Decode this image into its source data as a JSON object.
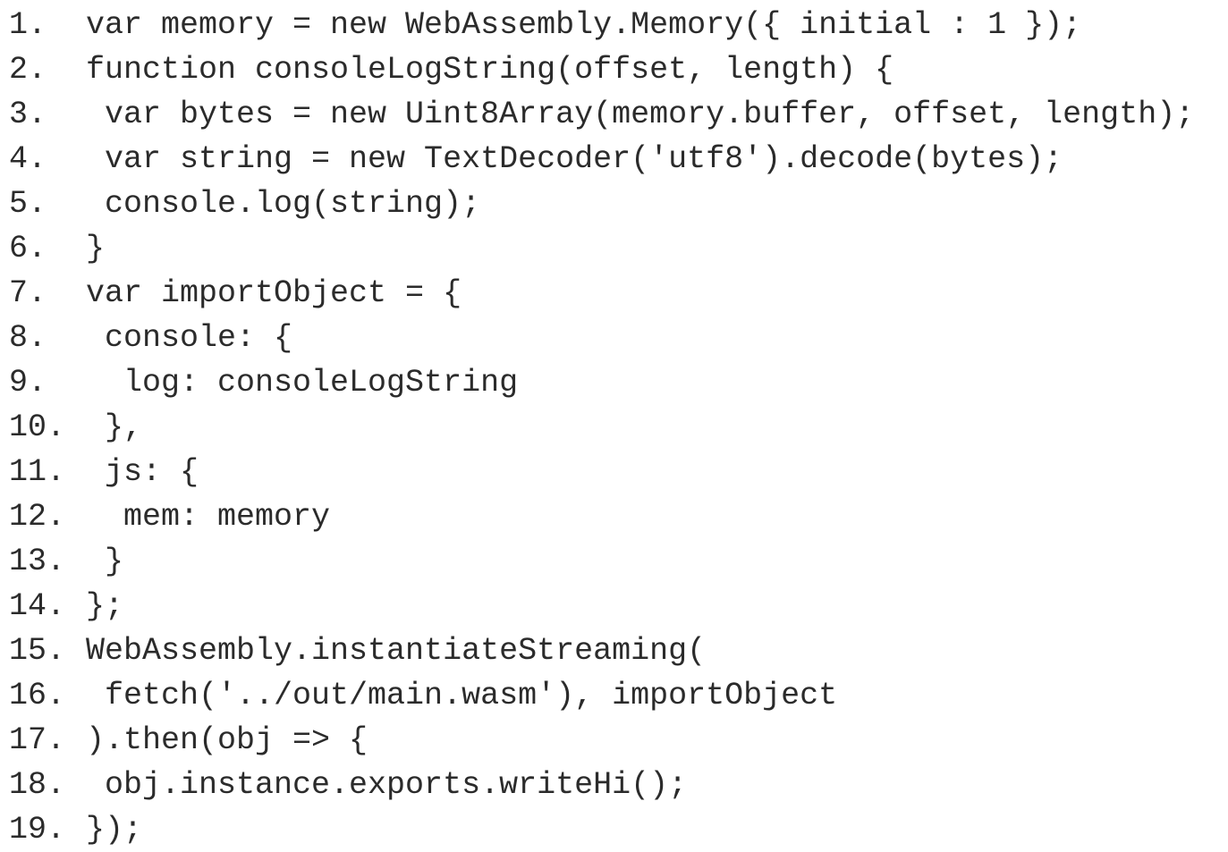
{
  "code_listing": {
    "lines": [
      {
        "number": "1.",
        "text": "var memory = new WebAssembly.Memory({ initial : 1 });"
      },
      {
        "number": "2.",
        "text": "function consoleLogString(offset, length) {"
      },
      {
        "number": "3.",
        "text": " var bytes = new Uint8Array(memory.buffer, offset, length);"
      },
      {
        "number": "4.",
        "text": " var string = new TextDecoder('utf8').decode(bytes);"
      },
      {
        "number": "5.",
        "text": " console.log(string);"
      },
      {
        "number": "6.",
        "text": "}"
      },
      {
        "number": "7.",
        "text": "var importObject = {"
      },
      {
        "number": "8.",
        "text": " console: {"
      },
      {
        "number": "9.",
        "text": "  log: consoleLogString"
      },
      {
        "number": "10.",
        "text": " },"
      },
      {
        "number": "11.",
        "text": " js: {"
      },
      {
        "number": "12.",
        "text": "  mem: memory"
      },
      {
        "number": "13.",
        "text": " }"
      },
      {
        "number": "14.",
        "text": "};"
      },
      {
        "number": "15.",
        "text": "WebAssembly.instantiateStreaming("
      },
      {
        "number": "16.",
        "text": " fetch('../out/main.wasm'), importObject"
      },
      {
        "number": "17.",
        "text": ").then(obj => {"
      },
      {
        "number": "18.",
        "text": " obj.instance.exports.writeHi();"
      },
      {
        "number": "19.",
        "text": "});"
      }
    ]
  },
  "colors": {
    "text": "#2b2b2b",
    "background": "#ffffff"
  }
}
